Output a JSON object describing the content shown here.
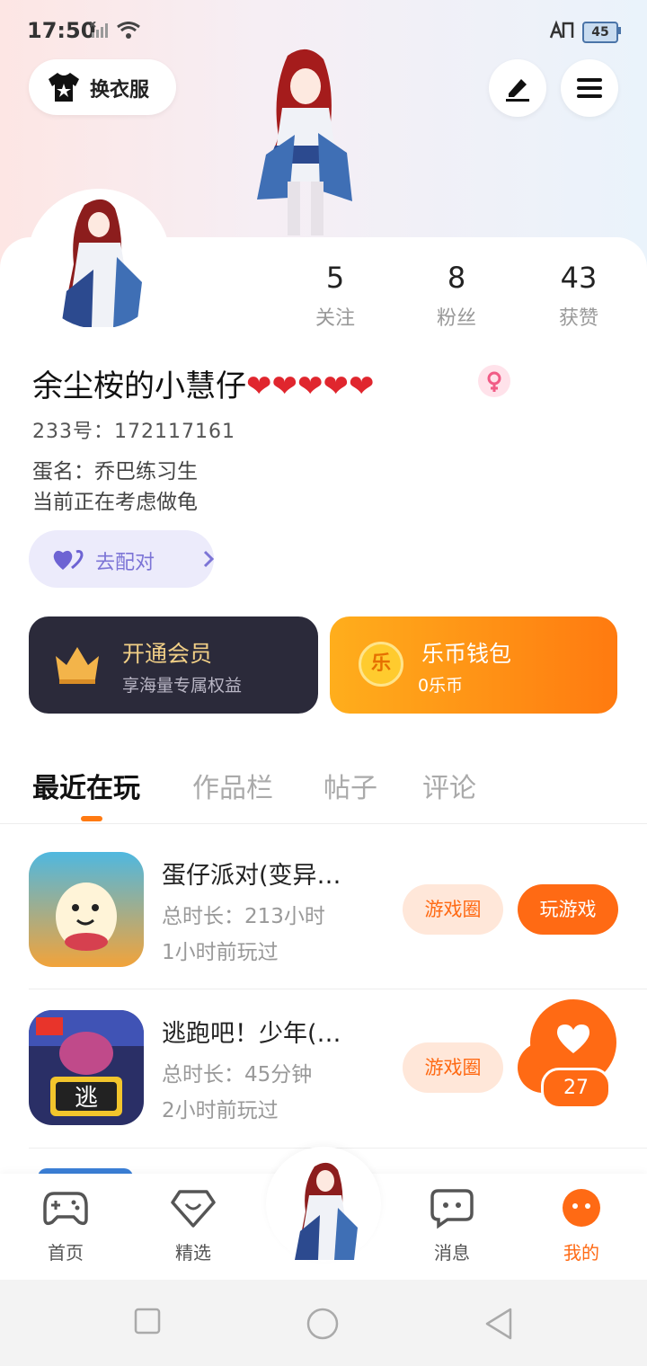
{
  "status_bar": {
    "time": "17:50",
    "battery": "45"
  },
  "header": {
    "dress_up_label": "换衣服"
  },
  "profile": {
    "stats": [
      {
        "value": "5",
        "label": "关注"
      },
      {
        "value": "8",
        "label": "粉丝"
      },
      {
        "value": "43",
        "label": "获赞"
      }
    ],
    "username": "余尘桉的小慧仔❤❤❤❤❤",
    "uid_label": "233号：",
    "uid": "172117161",
    "bio_line1": "蛋名：乔巴练习生",
    "bio_line2": "当前正在考虑做龟",
    "pair_label": "去配对"
  },
  "cards": {
    "vip_title": "开通会员",
    "vip_subtitle": "享海量专属权益",
    "wallet_title": "乐币钱包",
    "wallet_subtitle": "0乐币",
    "coin_glyph": "乐"
  },
  "tabs": [
    "最近在玩",
    "作品栏",
    "帖子",
    "评论"
  ],
  "games": [
    {
      "name": "蛋仔派对(变异…",
      "duration": "总时长：213小时",
      "last_played": "1小时前玩过",
      "circle_label": "游戏圈",
      "play_label": "玩游戏"
    },
    {
      "name": "逃跑吧！少年(…",
      "duration": "总时长：45分钟",
      "last_played": "2小时前玩过",
      "circle_label": "游戏圈",
      "icon_text": "逃"
    }
  ],
  "floater": {
    "count": "27"
  },
  "bottom_nav": [
    {
      "label": "首页"
    },
    {
      "label": "精选"
    },
    {
      "label": "消息"
    },
    {
      "label": "我的"
    }
  ],
  "colors": {
    "accent": "#ff6a14",
    "vip_bg": "#2b2a3a",
    "pair_bg": "#ecebfb"
  }
}
